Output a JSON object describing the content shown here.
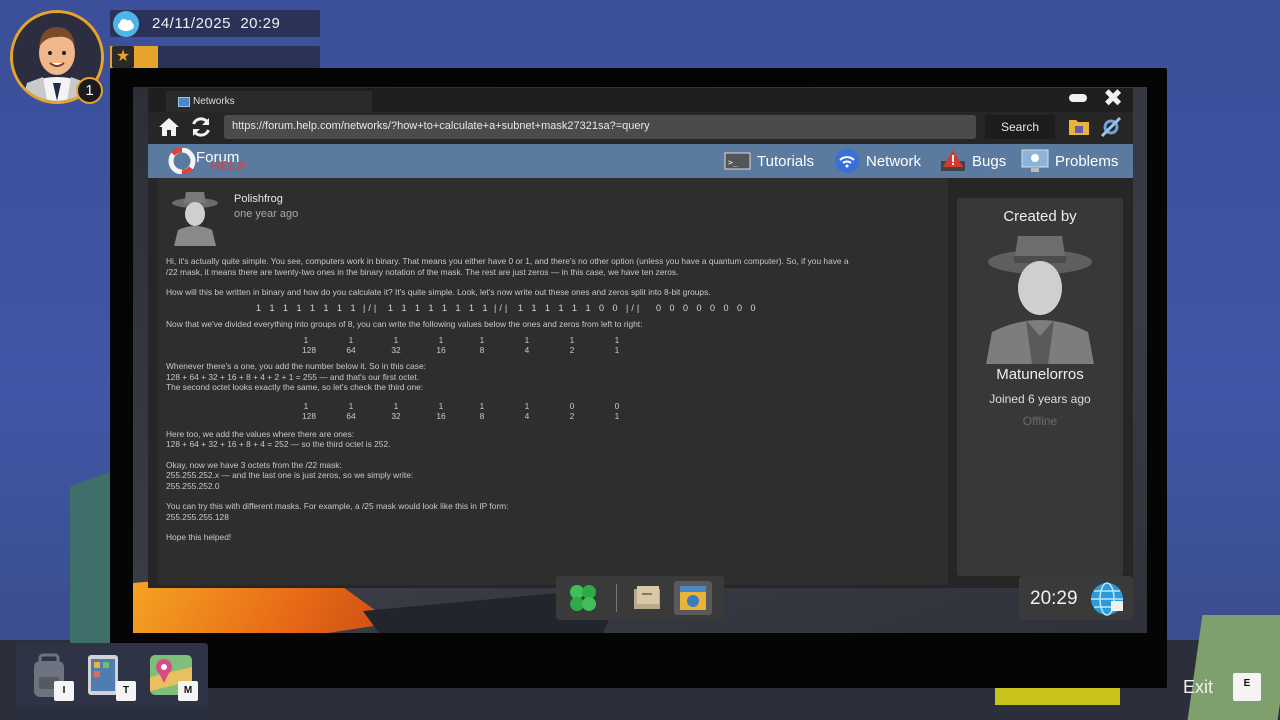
{
  "hud": {
    "date": "24/11/2025",
    "time": "20:29",
    "level": "1",
    "xp_fraction": 0.23,
    "accent_color": "#e6a52a",
    "icons": {
      "avatar": "player-avatar",
      "weather": "cloud-icon",
      "star": "star-icon"
    }
  },
  "browser": {
    "tab_title": "Networks",
    "url": "https://forum.help.com/networks/?how+to+calculate+a+subnet+mask27321sa?=query",
    "search_label": "Search",
    "close_glyph": "✖"
  },
  "forum": {
    "logo_title": "Forum",
    "logo_subtitle": "HELP",
    "nav": [
      {
        "label": "Tutorials",
        "icon": "tutorials-icon"
      },
      {
        "label": "Network",
        "icon": "wifi-icon"
      },
      {
        "label": "Bugs",
        "icon": "warning-icon"
      },
      {
        "label": "Problems",
        "icon": "monitor-icon"
      }
    ]
  },
  "post": {
    "author": "Polishfrog",
    "time": "one year ago",
    "para1": [
      "Hi, it's actually quite simple. You see, computers work in binary. That means you either have 0 or 1, and there's no other option (unless you have a quantum computer). So, if you have a",
      "/22 mask, it means there are twenty-two ones in the binary notation of the mask. The rest are just zeros — in this case, we have ten zeros."
    ],
    "para2": "How will this be written in binary and how do you calculate it? It's quite simple. Look, let's now write out these ones and zeros split into 8-bit groups.",
    "binary_groups": [
      "1 1 1 1 1 1 1 1",
      "|/|",
      "1 1 1 1 1 1 1 1",
      "|/|",
      "1 1 1 1 1 1 0 0",
      "|/|",
      "0 0 0 0 0 0 0 0"
    ],
    "para3": "Now that we've divided everything into groups of 8, you can write the following values below the ones and zeros from left to right:",
    "table1_bits": [
      "1",
      "1",
      "1",
      "1",
      "1",
      "1",
      "1",
      "1"
    ],
    "place_values": [
      "128",
      "64",
      "32",
      "16",
      "8",
      "4",
      "2",
      "1"
    ],
    "para4": [
      "Whenever there's a one, you add the number below it. So in this case:",
      "128 + 64 + 32 + 16 + 8 + 4 + 2 + 1 = 255 — and that's our first octet.",
      "The second octet looks exactly the same, so let's check the third one:"
    ],
    "table2_bits": [
      "1",
      "1",
      "1",
      "1",
      "1",
      "1",
      "0",
      "0"
    ],
    "para5": [
      "Here too, we add the values where there are ones:",
      "128 + 64 + 32 + 16 + 8 + 4 = 252 — so the third octet is 252."
    ],
    "para6": [
      "Okay, now we have 3 octets from the /22 mask:",
      "255.255.252.x — and the last one is just zeros, so we simply write:",
      "255.255.252.0"
    ],
    "para7": [
      "You can try this with different masks. For example, a /25 mask would look like this in IP form:",
      "255.255.255.128"
    ],
    "para8": "Hope this helped!"
  },
  "sidebar": {
    "created_by": "Created by",
    "username": "Matunelorros",
    "joined": "Joined 6 years ago",
    "status": "Offline"
  },
  "taskbar": {
    "clock": "20:29",
    "apps": [
      "clover-app-icon",
      "files-app-icon",
      "browser-app-icon"
    ],
    "tray_icon": "network-globe-icon"
  },
  "inventory": [
    {
      "icon": "backpack-icon",
      "key": "I"
    },
    {
      "icon": "tablet-icon",
      "key": "T"
    },
    {
      "icon": "map-icon",
      "key": "M"
    }
  ],
  "exit": {
    "label": "Exit",
    "key": "E"
  }
}
